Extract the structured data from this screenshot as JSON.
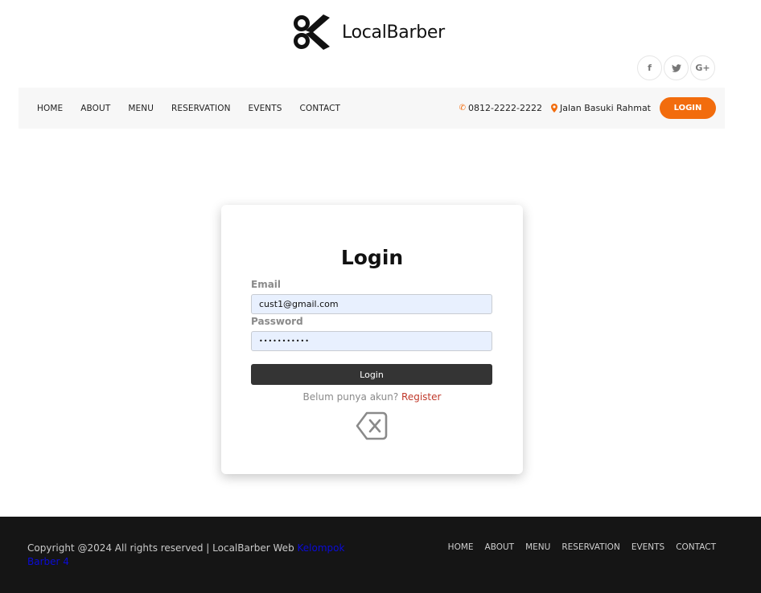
{
  "header": {
    "brand_name": "LocalBarber",
    "social": [
      {
        "icon": "facebook-icon",
        "glyph": "f"
      },
      {
        "icon": "twitter-icon",
        "glyph": "t"
      },
      {
        "icon": "google-plus-icon",
        "glyph": "G+"
      }
    ]
  },
  "nav": {
    "links": [
      "HOME",
      "ABOUT",
      "MENU",
      "RESERVATION",
      "EVENTS",
      "CONTACT"
    ],
    "phone": "0812-2222-2222",
    "address": "Jalan Basuki Rahmat",
    "login_label": "LOGIN"
  },
  "login": {
    "title": "Login",
    "email_label": "Email",
    "email_value": "cust1@gmail.com",
    "password_label": "Password",
    "password_value": "•••••••••••",
    "submit_label": "Login",
    "register_prompt": "Belum punya akun?",
    "register_link": "Register"
  },
  "footer": {
    "copyright": "Copyright @2024 All rights reserved | LocalBarber Web",
    "credit_link": "Kelompok Barber 4",
    "links": [
      "HOME",
      "ABOUT",
      "MENU",
      "RESERVATION",
      "EVENTS",
      "CONTACT"
    ]
  },
  "colors": {
    "accent": "#f26c0d",
    "dark_button": "#343434",
    "footer_bg": "#151515",
    "register_link": "#c0392b"
  }
}
